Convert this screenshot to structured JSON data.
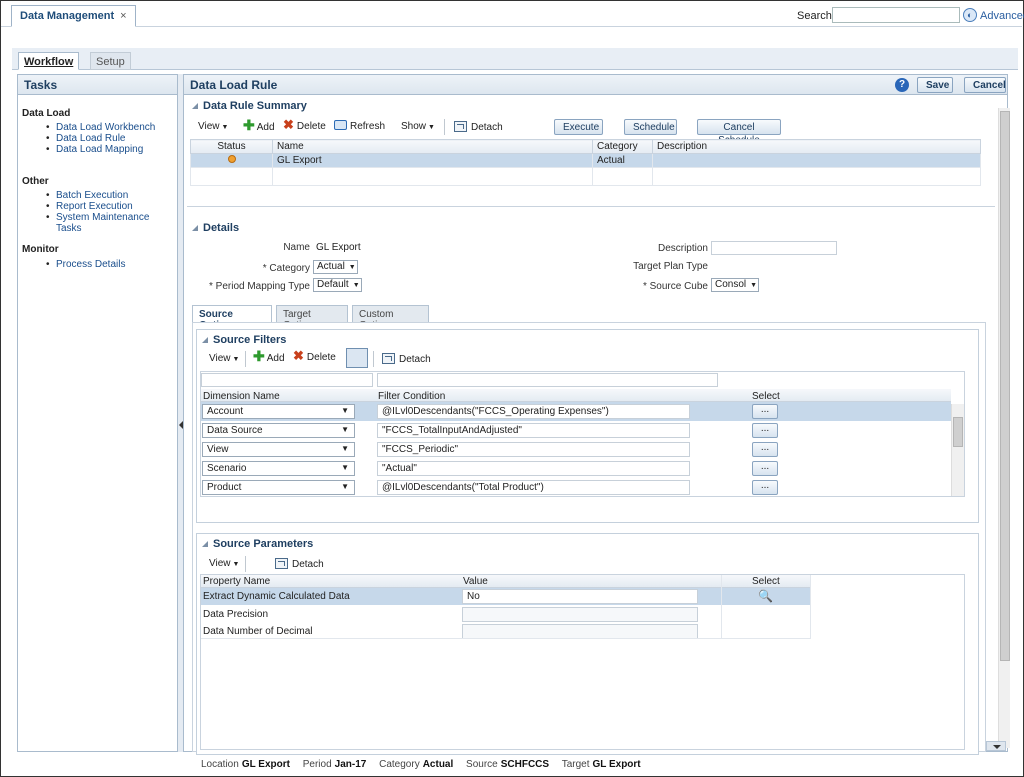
{
  "app_tab": {
    "label": "Data Management",
    "close": "×"
  },
  "search": {
    "label": "Search:",
    "placeholder": "",
    "advanced_label": "Advanced"
  },
  "ws_tabs": {
    "workflow": "Workflow",
    "setup": "Setup"
  },
  "tasks": {
    "title": "Tasks",
    "groups": [
      {
        "label": "Data Load",
        "items": [
          "Data Load Workbench",
          "Data Load Rule",
          "Data Load Mapping"
        ]
      },
      {
        "label": "Other",
        "items": [
          "Batch Execution",
          "Report Execution",
          "System Maintenance Tasks"
        ]
      },
      {
        "label": "Monitor",
        "items": [
          "Process Details"
        ]
      }
    ]
  },
  "main": {
    "title": "Data Load Rule",
    "help": "?",
    "save_label": "Save",
    "cancel_label": "Cancel"
  },
  "summary": {
    "title": "Data Rule Summary",
    "toolbar": {
      "view": "View",
      "add": "Add",
      "delete": "Delete",
      "refresh": "Refresh",
      "show": "Show",
      "detach": "Detach"
    },
    "buttons": {
      "execute": "Execute",
      "schedule": "Schedule",
      "cancel_schedule": "Cancel Schedule"
    },
    "columns": [
      "Status",
      "Name",
      "Category",
      "Description"
    ],
    "rows": [
      {
        "status": "",
        "name": "GL Export",
        "category": "Actual",
        "description": ""
      }
    ]
  },
  "details": {
    "title": "Details",
    "name_label": "Name",
    "name_value": "GL Export",
    "category_label": "* Category",
    "category_value": "Actual",
    "pmt_label": "* Period Mapping Type",
    "pmt_value": "Default",
    "description_label": "Description",
    "description_value": "",
    "target_plan_label": "Target Plan Type",
    "source_cube_label": "* Source Cube",
    "source_cube_value": "Consol"
  },
  "subtabs": {
    "source": "Source Options",
    "target": "Target Options",
    "custom": "Custom Options"
  },
  "source_filters": {
    "title": "Source Filters",
    "toolbar": {
      "view": "View",
      "add": "Add",
      "delete": "Delete",
      "detach": "Detach"
    },
    "columns": {
      "dimension": "Dimension Name",
      "filter": "Filter Condition",
      "select": "Select"
    },
    "rows": [
      {
        "dimension": "Account",
        "filter": "@ILvl0Descendants(\"FCCS_Operating Expenses\")",
        "select": "..."
      },
      {
        "dimension": "Data Source",
        "filter": "\"FCCS_TotalInputAndAdjusted\"",
        "select": "..."
      },
      {
        "dimension": "View",
        "filter": "\"FCCS_Periodic\"",
        "select": "..."
      },
      {
        "dimension": "Scenario",
        "filter": "\"Actual\"",
        "select": "..."
      },
      {
        "dimension": "Product",
        "filter": "@ILvl0Descendants(\"Total Product\")",
        "select": "..."
      }
    ]
  },
  "source_params": {
    "title": "Source Parameters",
    "toolbar": {
      "view": "View",
      "detach": "Detach"
    },
    "columns": {
      "property": "Property Name",
      "value": "Value",
      "select": "Select"
    },
    "rows": [
      {
        "property": "Extract Dynamic Calculated Data",
        "value": "No"
      },
      {
        "property": "Data Precision",
        "value": ""
      },
      {
        "property": "Data Number of Decimal",
        "value": ""
      }
    ]
  },
  "context_bar": {
    "location_label": "Location",
    "location_value": "GL Export",
    "period_label": "Period",
    "period_value": "Jan-17",
    "category_label": "Category",
    "category_value": "Actual",
    "source_label": "Source",
    "source_value": "SCHFCCS",
    "target_label": "Target",
    "target_value": "GL Export"
  }
}
